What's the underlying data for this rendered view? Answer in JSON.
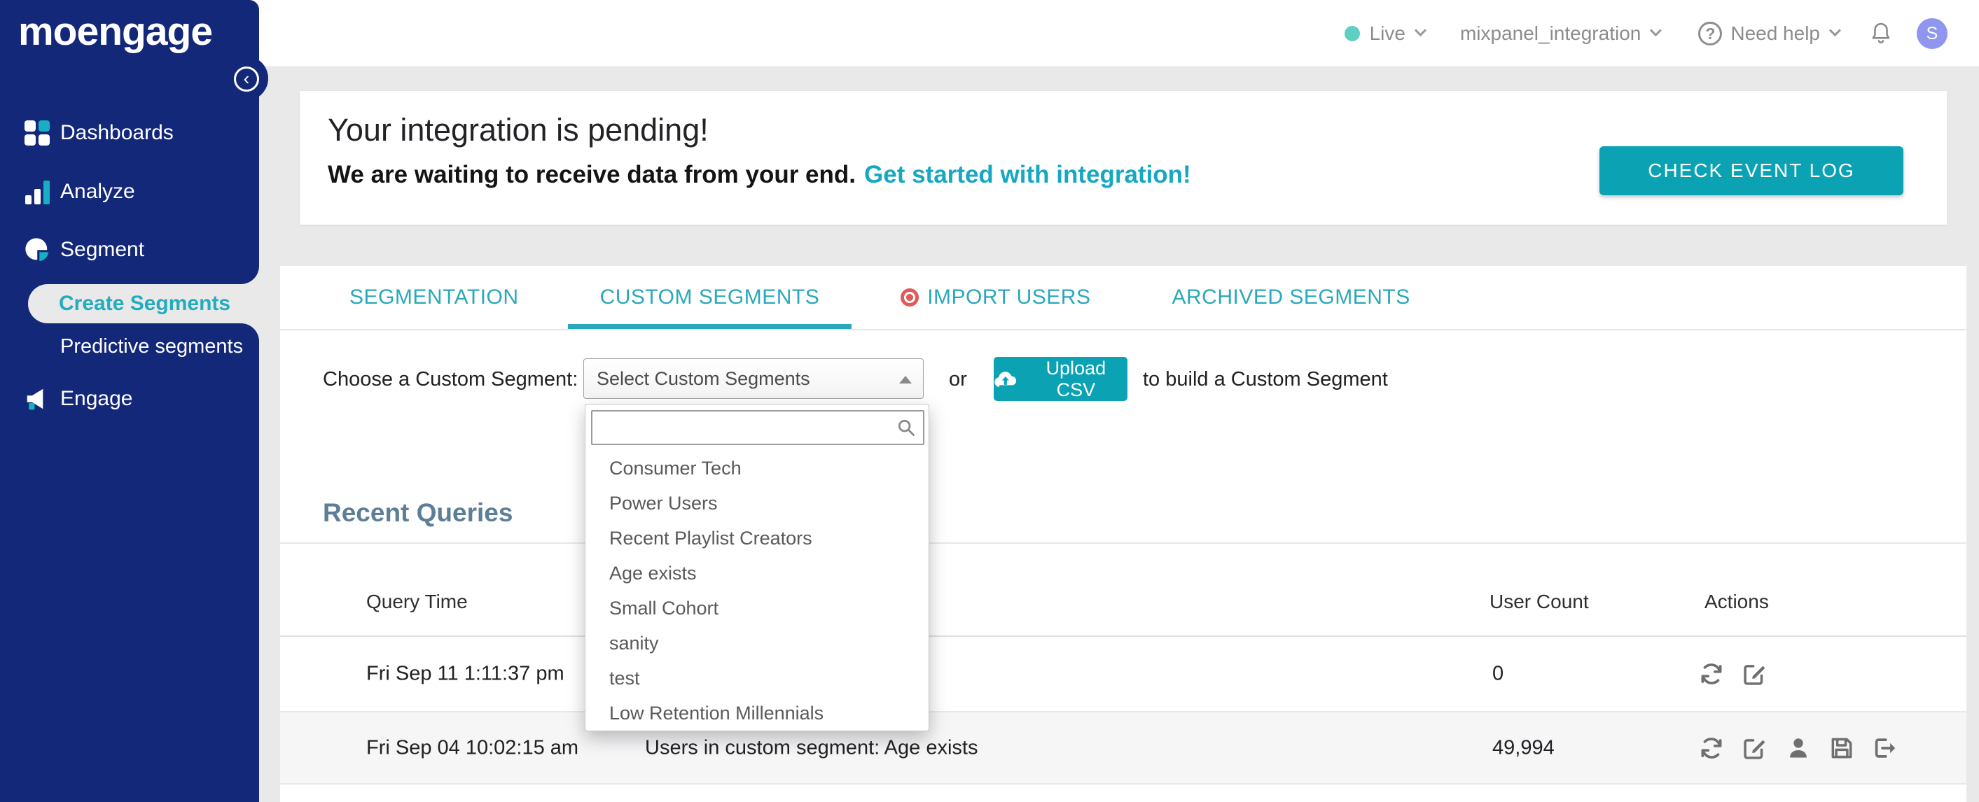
{
  "colors": {
    "sidebar_navy": "#14287A",
    "accent_teal": "#0BA2B4",
    "tab_teal": "#2AA8BB",
    "link_teal": "#16A7C2",
    "heading_slate": "#5C7E96",
    "import_dot_red": "#E25A5A",
    "avatar_purple": "#8F96EF",
    "live_dot_teal": "#5FCFC3",
    "page_background": "#E9E9EA"
  },
  "sidebar": {
    "logo": "moengage",
    "items": [
      {
        "label": "Dashboards",
        "icon": "dashboards-grid-icon"
      },
      {
        "label": "Analyze",
        "icon": "bar-chart-icon"
      },
      {
        "label": "Segment",
        "icon": "pie-chart-icon"
      },
      {
        "label": "Engage",
        "icon": "megaphone-icon"
      }
    ],
    "sub_items": [
      {
        "label": "Create Segments",
        "active": true
      },
      {
        "label": "Predictive segments",
        "active": false
      }
    ],
    "collapse_glyph": "‹"
  },
  "topbar": {
    "environment": "Live",
    "project": "mixpanel_integration",
    "help_label": "Need help",
    "help_glyph": "?",
    "avatar_initial": "S",
    "icons": [
      "live-dot",
      "chevron-down-icon",
      "help-circle-icon",
      "bell-icon",
      "avatar"
    ]
  },
  "banner": {
    "title": "Your integration is pending!",
    "message": "We are waiting to receive data from your end.",
    "link": "Get started with integration!",
    "button": "CHECK EVENT LOG"
  },
  "tabs": [
    {
      "label": "SEGMENTATION",
      "active": false,
      "has_red_dot": false
    },
    {
      "label": "CUSTOM SEGMENTS",
      "active": true,
      "has_red_dot": false
    },
    {
      "label": "IMPORT USERS",
      "active": false,
      "has_red_dot": true
    },
    {
      "label": "ARCHIVED SEGMENTS",
      "active": false,
      "has_red_dot": false
    }
  ],
  "chooser": {
    "label": "Choose a Custom Segment:",
    "select_value": "Select Custom Segments",
    "or": "or",
    "upload_button": "Upload CSV",
    "upload_icon": "cloud-upload-icon",
    "suffix": "to build a Custom Segment"
  },
  "dropdown": {
    "search_placeholder": "",
    "search_icon": "search-icon",
    "items": [
      "Consumer Tech",
      "Power Users",
      "Recent Playlist Creators",
      "Age exists",
      "Small Cohort",
      "sanity",
      "test",
      "Low Retention Millennials"
    ]
  },
  "recent_queries": {
    "heading": "Recent Queries"
  },
  "table": {
    "headers": {
      "query_time": "Query Time",
      "user_count": "User Count",
      "actions": "Actions"
    },
    "rows": [
      {
        "query_time": "Fri Sep 11 1:11:37 pm",
        "description": "",
        "user_count": "0",
        "actions": [
          "refresh",
          "edit"
        ]
      },
      {
        "query_time": "Fri Sep 04 10:02:15 am",
        "description": "Users in custom segment: Age exists",
        "user_count": "49,994",
        "actions": [
          "refresh",
          "edit",
          "user",
          "save",
          "export"
        ]
      }
    ]
  }
}
